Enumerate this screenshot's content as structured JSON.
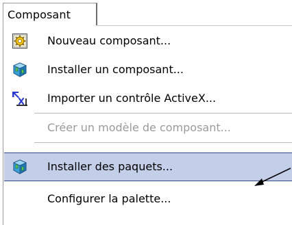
{
  "menu_title": "Composant",
  "items": [
    {
      "label": "Nouveau composant...",
      "icon": "new-component-icon",
      "enabled": true
    },
    {
      "label": "Installer un composant...",
      "icon": "install-component-icon",
      "enabled": true
    },
    {
      "label": "Importer un contrôle ActiveX...",
      "icon": "import-activex-icon",
      "enabled": true
    },
    {
      "label": "Créer un modèle de composant...",
      "enabled": false
    },
    {
      "label": "Installer des paquets...",
      "icon": "install-packages-icon",
      "enabled": true,
      "highlighted": true
    },
    {
      "label": "Configurer la palette...",
      "enabled": true
    }
  ],
  "colors": {
    "highlight_background": "#c3cee8",
    "highlight_border": "#304a85",
    "disabled_text": "#9a9a9a",
    "menu_background": "#ffffff"
  }
}
